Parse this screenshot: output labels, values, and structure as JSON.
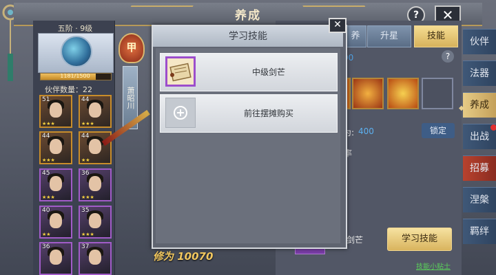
{
  "header": {
    "title": "养成"
  },
  "hero": {
    "rank": "五阶 · 9级",
    "xp": {
      "text": "1181/1500",
      "current": 1181,
      "max": 1500
    },
    "emblem": "甲",
    "name_banner": "萧昭川",
    "cultivation_text": "修为 10070"
  },
  "partners": {
    "count_label": "伙伴数量：22",
    "cards": [
      {
        "level": "51",
        "stars": "★★★",
        "rarity": "orange"
      },
      {
        "level": "44",
        "stars": "★★★",
        "rarity": "orange"
      },
      {
        "level": "44",
        "stars": "★★★",
        "rarity": "orange"
      },
      {
        "level": "44",
        "stars": "★★",
        "rarity": "orange"
      },
      {
        "level": "45",
        "stars": "★★★",
        "rarity": "purple"
      },
      {
        "level": "36",
        "stars": "★★★",
        "rarity": "purple"
      },
      {
        "level": "40",
        "stars": "★★",
        "rarity": "purple"
      },
      {
        "level": "35",
        "stars": "★★★",
        "rarity": "purple"
      },
      {
        "level": "36",
        "stars": "",
        "rarity": "purple"
      },
      {
        "level": "37",
        "stars": "",
        "rarity": "purple"
      }
    ]
  },
  "tabs": {
    "partial": "养",
    "upgrade": "升星",
    "skill": "技能"
  },
  "skills_panel": {
    "points_partial": "00",
    "stat_label": "为:",
    "stat_value": "400",
    "lock_label": "锁定",
    "partial_glyph": "率",
    "selected_skill_partial": "剑芒",
    "learn_button": "学习技能",
    "footer_link": "技能小贴士"
  },
  "right_nav": [
    {
      "label": "伙伴",
      "state": "normal"
    },
    {
      "label": "法器",
      "state": "normal"
    },
    {
      "label": "养成",
      "state": "active"
    },
    {
      "label": "出战",
      "state": "normal"
    },
    {
      "label": "招募",
      "state": "red"
    },
    {
      "label": "涅槃",
      "state": "normal"
    },
    {
      "label": "羁绊",
      "state": "normal"
    }
  ],
  "modal": {
    "title": "学习技能",
    "items": [
      {
        "label": "中级剑芒",
        "icon": "scroll-icon"
      },
      {
        "label": "前往摆摊购买",
        "icon": "plus-icon"
      }
    ]
  },
  "colors": {
    "accent_gold": "#d7b25c",
    "purple_rarity": "#9c4dcc",
    "orange_rarity": "#c98d2a",
    "link_green": "#5ad05a",
    "value_blue": "#5cb0f0"
  }
}
